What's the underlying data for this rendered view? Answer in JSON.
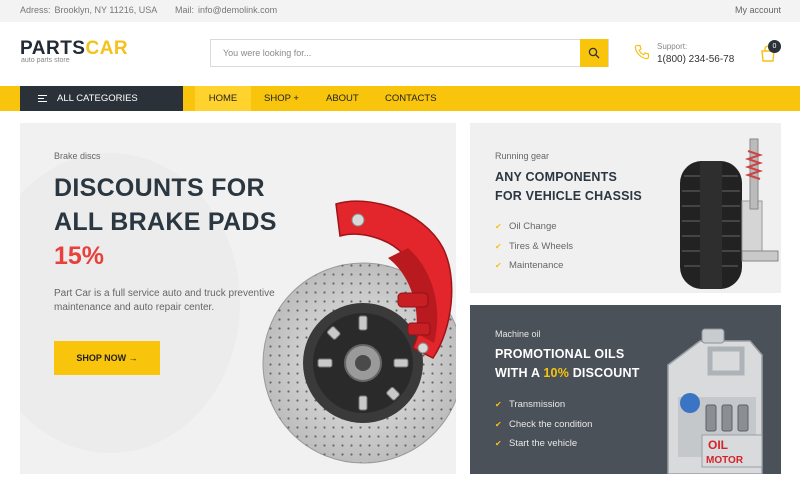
{
  "topbar": {
    "address_label": "Adress:",
    "address": "Brooklyn, NY 11216, USA",
    "mail_label": "Mail:",
    "mail": "info@demolink.com",
    "account": "My account"
  },
  "header": {
    "logo_part1": "PARTS",
    "logo_part2": "CAR",
    "logo_sub": "auto parts store",
    "search_placeholder": "You were looking for...",
    "support_label": "Support:",
    "support_phone": "1(800) 234-56-78",
    "cart_count": "0"
  },
  "nav": {
    "all_categories": "ALL CATEGORIES",
    "items": [
      {
        "label": "HOME"
      },
      {
        "label": "SHOP +"
      },
      {
        "label": "ABOUT"
      },
      {
        "label": "CONTACTS"
      }
    ]
  },
  "hero": {
    "kicker": "Brake discs",
    "title": "DISCOUNTS FOR ALL BRAKE PADS",
    "percent": "15%",
    "description": "Part Car is a full service auto and truck preventive maintenance and auto repair center.",
    "button": "SHOP NOW →"
  },
  "card1": {
    "kicker": "Running gear",
    "title_line1": "ANY COMPONENTS",
    "title_line2": "FOR VEHICLE CHASSIS",
    "items": [
      "Oil Change",
      "Tires & Wheels",
      "Maintenance"
    ]
  },
  "card2": {
    "kicker": "Machine oil",
    "title_line1": "PROMOTIONAL OILS",
    "title_line2_pre": "WITH A ",
    "title_line2_hl": "10%",
    "title_line2_post": " DISCOUNT",
    "items": [
      "Transmission",
      "Check the condition",
      "Start the vehicle"
    ],
    "jug_label": "OIL MOTOR"
  },
  "colors": {
    "accent": "#f8c40c",
    "dark": "#2b3138",
    "sale_red": "#e8403a",
    "card_dark": "#4b5159"
  }
}
